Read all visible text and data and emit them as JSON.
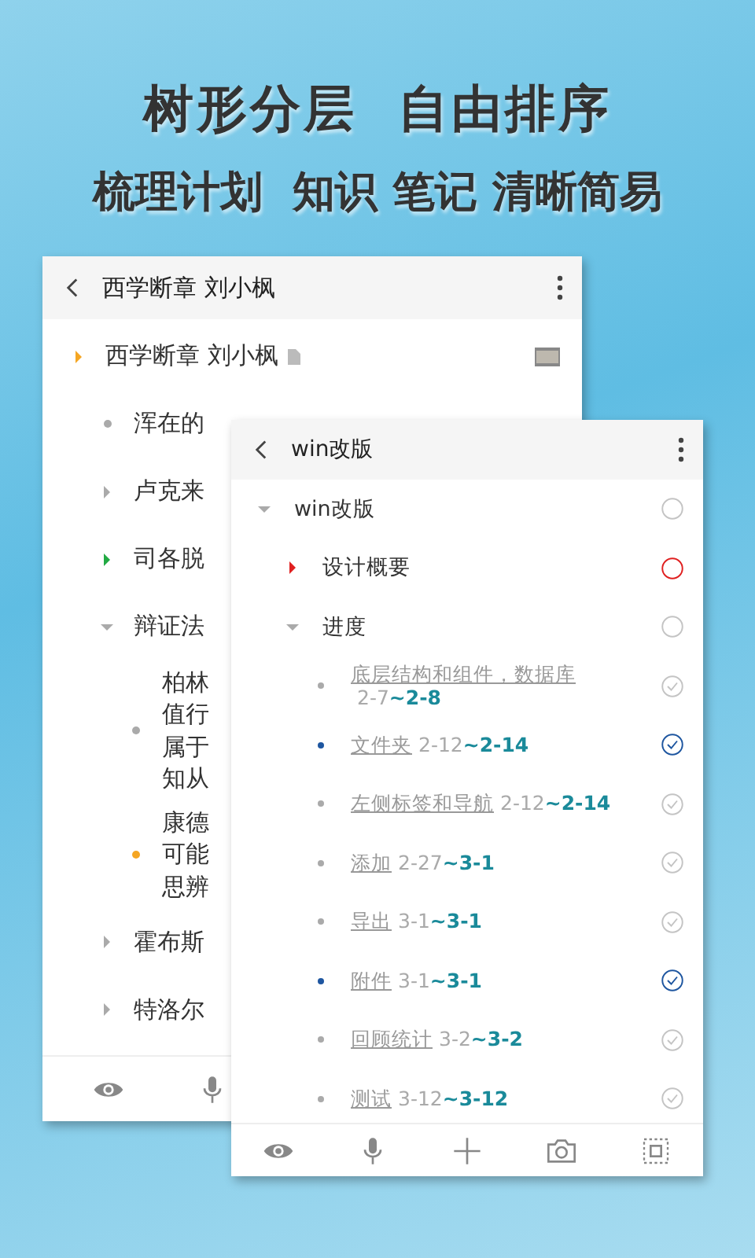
{
  "headline": "树形分层  自由排序",
  "subheadline": "梳理计划  知识 笔记 清晰简易",
  "back": {
    "title": "西学断章 刘小枫",
    "items": [
      {
        "kind": "folder",
        "text": "西学断章 刘小枫",
        "color": "#f5a623",
        "expanded": false,
        "doc": true,
        "thumb": true,
        "children": [
          {
            "kind": "note",
            "lines": [
              "浑在的"
            ],
            "color": "#aaaaaa"
          },
          {
            "kind": "folder",
            "text": "卢克来",
            "color": "#aaaaaa",
            "expanded": false
          },
          {
            "kind": "folder",
            "text": "司各脱",
            "color": "#22aa44",
            "expanded": false
          },
          {
            "kind": "folder",
            "text": "辩证法",
            "color": "#aaaaaa",
            "expanded": true,
            "children": [
              {
                "kind": "note",
                "lines": [
                  "柏林",
                  "值行",
                  "属于",
                  "知从"
                ],
                "color": "#aaaaaa"
              },
              {
                "kind": "note",
                "lines": [
                  "康德",
                  "可能",
                  "思辨"
                ],
                "color": "#f5a623"
              }
            ]
          },
          {
            "kind": "folder",
            "text": "霍布斯",
            "color": "#aaaaaa",
            "expanded": false
          },
          {
            "kind": "folder",
            "text": "特洛尔",
            "color": "#aaaaaa",
            "expanded": false
          }
        ]
      }
    ]
  },
  "front": {
    "title": "win改版",
    "items": [
      {
        "kind": "folder",
        "text": "win改版",
        "color": "#aaaaaa",
        "expanded": true,
        "done": false,
        "children": [
          {
            "kind": "folder",
            "text": "设计概要",
            "color": "#e02020",
            "expanded": false,
            "done": false
          },
          {
            "kind": "folder",
            "text": "进度",
            "color": "#aaaaaa",
            "expanded": true,
            "done": false,
            "children": [
              {
                "kind": "task",
                "text": "底层结构和组件，数据库",
                "start": "2-7",
                "end": "~2-8",
                "color": "#aaaaaa",
                "done": true
              },
              {
                "kind": "task",
                "text": "文件夹",
                "start": "2-12",
                "end": "~2-14",
                "color": "#1e56a0",
                "done": true
              },
              {
                "kind": "task",
                "text": "左侧标签和导航",
                "start": "2-12",
                "end": "~2-14",
                "color": "#aaaaaa",
                "done": true
              },
              {
                "kind": "task",
                "text": "添加",
                "start": "2-27",
                "end": "~3-1",
                "color": "#aaaaaa",
                "done": true
              },
              {
                "kind": "task",
                "text": "导出",
                "start": "3-1",
                "end": "~3-1",
                "color": "#aaaaaa",
                "done": true
              },
              {
                "kind": "task",
                "text": "附件",
                "start": "3-1",
                "end": "~3-1",
                "color": "#1e56a0",
                "done": true
              },
              {
                "kind": "task",
                "text": "回顾统计",
                "start": "3-2",
                "end": "~3-2",
                "color": "#aaaaaa",
                "done": true
              },
              {
                "kind": "task",
                "text": "测试",
                "start": "3-12",
                "end": "~3-12",
                "color": "#aaaaaa",
                "done": true
              }
            ]
          }
        ]
      }
    ]
  }
}
